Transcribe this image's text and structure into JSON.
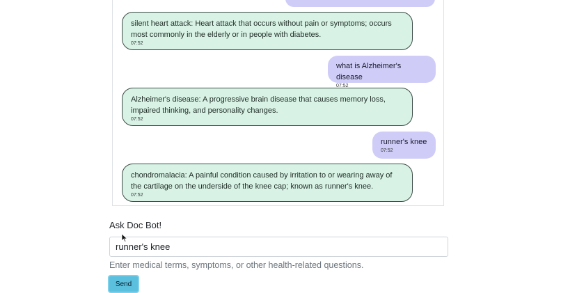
{
  "messages": [
    {
      "role": "bot",
      "text": "silent heart attack: Heart attack that occurs without pain or symptoms; occurs most commonly in the elderly or in people with diabetes.",
      "time": "07:52"
    },
    {
      "role": "user",
      "text": "what is Alzheimer's disease",
      "time": "07:52"
    },
    {
      "role": "bot",
      "text": "Alzheimer's disease: A progressive brain disease that causes memory loss, impaired thinking, and personality changes.",
      "time": "07:52"
    },
    {
      "role": "user",
      "text": "runner's knee",
      "time": "07:52"
    },
    {
      "role": "bot",
      "text": "chondromalacia: A painful condition caused by irritation to or wearing away of the cartilage on the underside of the knee cap; known as runner's knee.",
      "time": "07:52"
    }
  ],
  "form": {
    "label": "Ask Doc Bot!",
    "input_value": "runner's knee",
    "help_text": "Enter medical terms, symptoms, or other health-related questions.",
    "send_label": "Send"
  },
  "colors": {
    "bot_bubble": "#d8f3e6",
    "user_bubble": "#cfcdf7",
    "send_button": "#5bc0de"
  },
  "icons": {
    "cursor": "mouse-pointer-icon"
  }
}
